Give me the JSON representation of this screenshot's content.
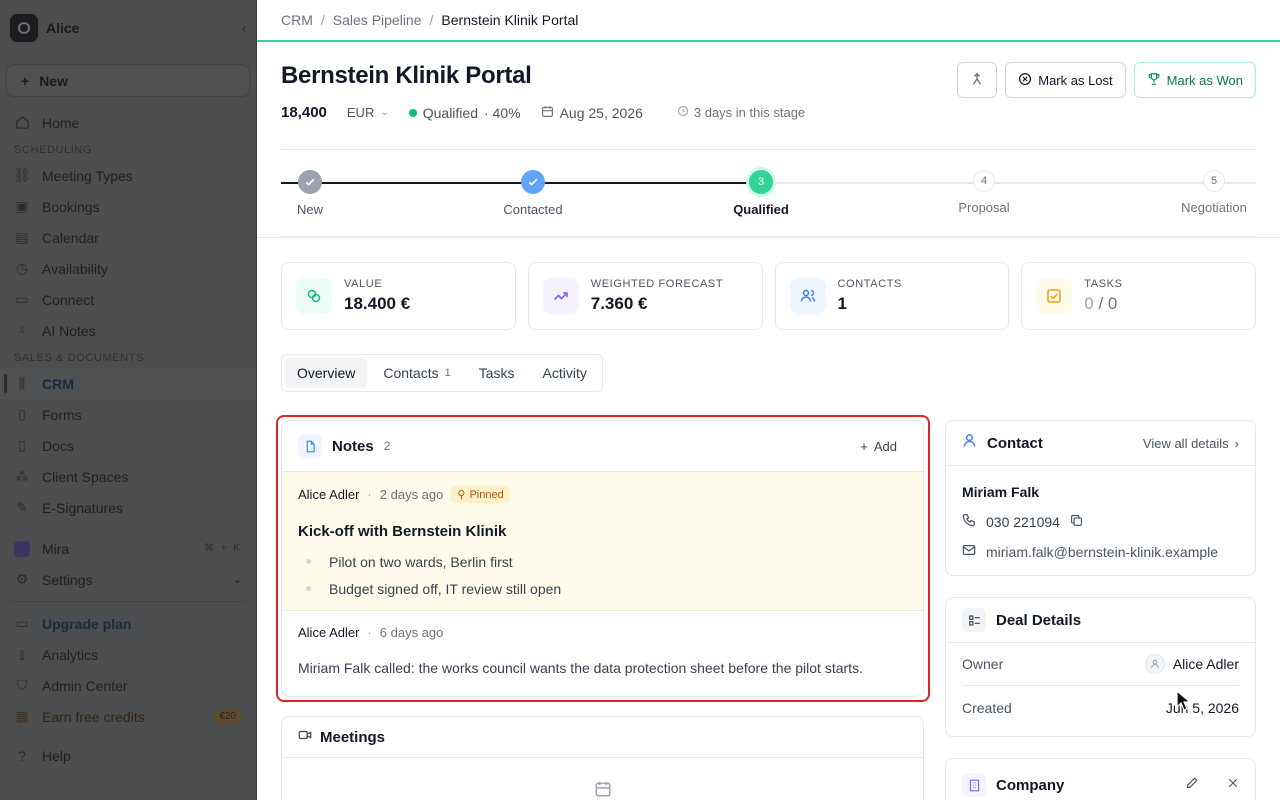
{
  "sidebar": {
    "workspace": "Alice",
    "new_label": "New",
    "home": "Home",
    "section_scheduling": "SCHEDULING",
    "scheduling_items": [
      "Meeting Types",
      "Bookings",
      "Calendar",
      "Availability",
      "Connect",
      "AI Notes"
    ],
    "section_sales": "SALES & DOCUMENTS",
    "sales_items": [
      "CRM",
      "Forms",
      "Docs",
      "Client Spaces",
      "E-Signatures"
    ],
    "mira": "Mira",
    "mira_shortcut": "⌘ + K",
    "settings": "Settings",
    "upgrade": "Upgrade plan",
    "analytics": "Analytics",
    "admin": "Admin Center",
    "credits": "Earn free credits",
    "credits_badge": "€20",
    "help": "Help"
  },
  "breadcrumb": [
    "CRM",
    "Sales Pipeline",
    "Bernstein Klinik Portal"
  ],
  "deal": {
    "title": "Bernstein Klinik Portal",
    "amount": "18,400",
    "currency": "EUR",
    "stage": "Qualified",
    "probability": "· 40%",
    "close_date": "Aug 25, 2026",
    "days_in_stage": "3 days in this stage"
  },
  "actions": {
    "lost": "Mark as Lost",
    "won": "Mark as Won"
  },
  "pipeline": {
    "current_index": 2,
    "steps": [
      {
        "label": "New",
        "num": "1",
        "state": "done"
      },
      {
        "label": "Contacted",
        "num": "2",
        "state": "done"
      },
      {
        "label": "Qualified",
        "num": "3",
        "state": "current"
      },
      {
        "label": "Proposal",
        "num": "4",
        "state": "todo"
      },
      {
        "label": "Negotiation",
        "num": "5",
        "state": "todo"
      }
    ]
  },
  "stats": [
    {
      "label": "VALUE",
      "value": "18.400 €",
      "color": "#10b981",
      "bg": "#ecfdf5"
    },
    {
      "label": "WEIGHTED FORECAST",
      "value": "7.360 €",
      "color": "#8b5cf6",
      "bg": "#f5f3ff"
    },
    {
      "label": "CONTACTS",
      "value": "1",
      "color": "#3b82f6",
      "bg": "#eff6ff"
    },
    {
      "label": "TASKS",
      "value_done": "0",
      "value_sep": " / ",
      "value_total": "0",
      "color": "#f59e0b",
      "bg": "#fffbeb"
    }
  ],
  "tabs": [
    {
      "label": "Overview",
      "active": true
    },
    {
      "label": "Contacts",
      "count": "1"
    },
    {
      "label": "Tasks"
    },
    {
      "label": "Activity"
    }
  ],
  "notes": {
    "title": "Notes",
    "count": "2",
    "add_label": "Add",
    "items": [
      {
        "author": "Alice Adler",
        "ago": "2 days ago",
        "pinned_label": "Pinned",
        "title": "Kick-off with Bernstein Klinik",
        "bullets": [
          "Pilot on two wards, Berlin first",
          "Budget signed off, IT review still open"
        ]
      },
      {
        "author": "Alice Adler",
        "ago": "6 days ago",
        "body": "Miriam Falk called: the works council wants the data protection sheet before the pilot starts."
      }
    ]
  },
  "meetings": {
    "title": "Meetings"
  },
  "contact": {
    "title": "Contact",
    "view_all": "View all details",
    "name": "Miriam Falk",
    "phone": "030 221094",
    "email": "miriam.falk@bernstein-klinik.example"
  },
  "deal_details": {
    "title": "Deal Details",
    "owner_label": "Owner",
    "owner": "Alice Adler",
    "created_label": "Created",
    "created": "Jun 5, 2026"
  },
  "company": {
    "title": "Company"
  }
}
